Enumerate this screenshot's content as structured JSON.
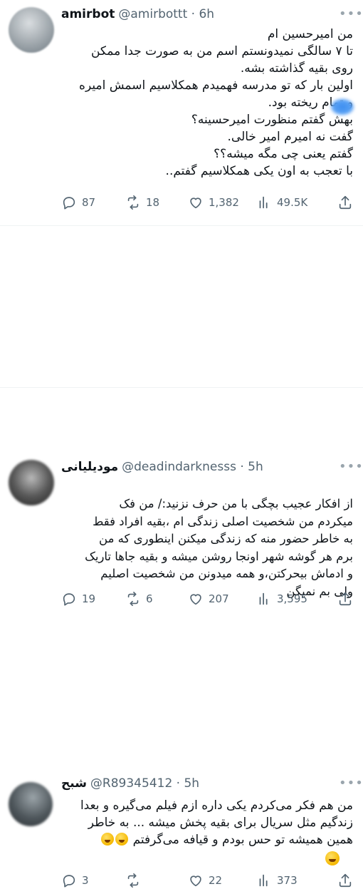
{
  "tweets": [
    {
      "name": "amirbot",
      "handle_time": "@amirbottt · 6h",
      "text": "من امیرحسین ام\nتا ۷ سالگی نمیدونستم اسم من به صورت جدا ممکن\nروی بقیه گذاشته بشه.\nاولین بار که تو مدرسه فهمیدم همکلاسیم اسمش امیره\nو تمام ریخته بود.\nبهش گفتم منظورت امیرحسینه؟\nگفت نه امیرم امیر خالی.\nگفتم یعنی چی مگه میشه؟؟\nبا تعجب به اون یکی همکلاسیم گفتم..",
      "stats": {
        "replies": "87",
        "retweets": "18",
        "likes": "1,382",
        "views": "49.5K"
      }
    },
    {
      "name": "مودیلیانی",
      "handle_time": "@deadindarknesss · 5h",
      "text": "از افکار عجیب بچگی با من حرف نزنید:/ من فک\nمیکردم من شخصیت اصلی زندگی ام ،بقیه افراد فقط\nبه خاطر حضور منه که زندگی میکنن اینطوری که من\nبرم هر گوشه شهر اونجا روشن میشه و بقیه جاها تاریک\nو ادماش بیحرکتن،و همه میدونن من شخصیت اصلیم\nولی بم نمیگن",
      "stats": {
        "replies": "19",
        "retweets": "6",
        "likes": "207",
        "views": "3,595"
      }
    },
    {
      "name": "شبح",
      "handle_time": "@R89345412 · 5h",
      "text": "من هم فکر می‌کردم یکی داره ازم فیلم می‌گیره و بعدا\nزندگیم مثل سریال برای بقیه پخش میشه ... به خاطر\nهمین همیشه تو حس بودم و قیافه می‌گرفتم",
      "stats": {
        "replies": "3",
        "retweets": "",
        "likes": "22",
        "views": "373"
      }
    }
  ],
  "icons": {
    "more": "more-icon",
    "reply": "reply-icon",
    "retweet": "retweet-icon",
    "like": "like-icon",
    "views": "views-icon",
    "share": "share-icon"
  },
  "colors": {
    "text": "#0f1419",
    "secondary": "#536471",
    "divider": "#eff3f4"
  }
}
